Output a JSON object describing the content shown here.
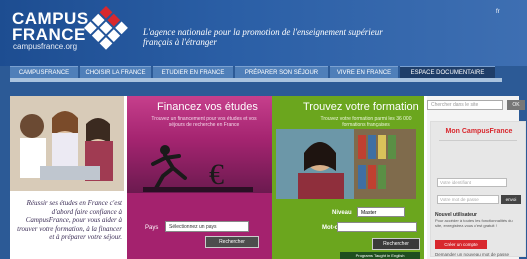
{
  "header": {
    "logo_campus": "CAMPUS",
    "logo_france": "FRANCE",
    "logo_url": "campusfrance.org",
    "tagline": "L'agence nationale pour la promotion de l'enseignement supérieur français à l'étranger",
    "lang": "fr"
  },
  "nav": {
    "items": [
      {
        "label": "CAMPUSFRANCE",
        "active": false
      },
      {
        "label": "CHOISIR LA FRANCE",
        "active": false
      },
      {
        "label": "ETUDIER EN FRANCE",
        "active": false
      },
      {
        "label": "PRÉPARER SON SÉJOUR",
        "active": false
      },
      {
        "label": "VIVRE EN FRANCE",
        "active": false
      },
      {
        "label": "ESPACE DOCUMENTAIRE",
        "active": true
      }
    ]
  },
  "promo_left": {
    "text": "Réussir ses études en France c'est d'abord faire confiance à CampusFrance, pour vous aider à trouver votre formation, à la financer et à préparer votre séjour."
  },
  "financement": {
    "title": "Financez vos études",
    "subtitle": "Trouvez un financement pour vos études et vos séjours de recherche en France",
    "pays_label": "Pays",
    "pays_select": "Sélectionnez un pays",
    "button": "Rechercher"
  },
  "formation": {
    "title": "Trouvez votre formation",
    "subtitle": "Trouvez votre formation parmi les 36 000 formations françaises",
    "niveau_label": "Niveau",
    "niveau_value": "Master",
    "motcle_label": "Mot-clé",
    "button": "Rechercher",
    "english_link": "Programs Taught in English"
  },
  "sidebar": {
    "search_placeholder": "Chercher dans le site",
    "search_button": "OK",
    "conn_title": "Mon CampusFrance",
    "id_placeholder": "Votre identifiant",
    "pw_placeholder": "Votre mot de passe",
    "ok_button": "envoi",
    "new_user": "Nouvel utilisateur",
    "new_desc": "Pour accéder à toutes les fonctionnalités du site, enregistrez-vous c'est gratuit !",
    "create_button": "Créer un compte",
    "forgot": "Demander un nouveau mot de passe"
  }
}
